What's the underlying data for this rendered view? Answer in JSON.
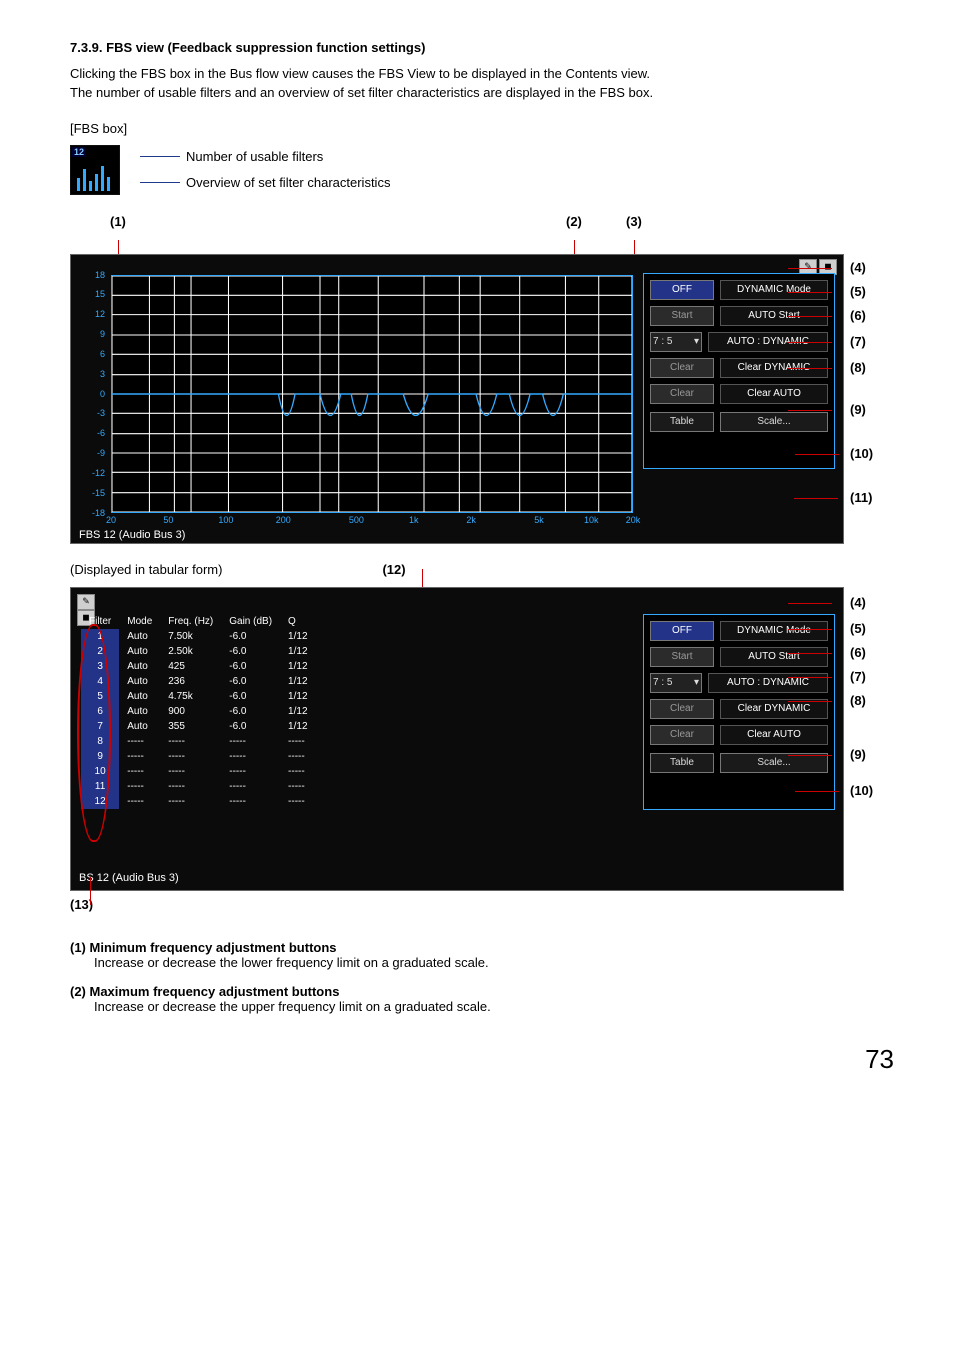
{
  "heading": "7.3.9. FBS view (Feedback suppression function settings)",
  "intro1": "Clicking the FBS box in the Bus flow view causes the FBS View to be displayed in the Contents view.",
  "intro2": "The number of usable filters and an overview of set filter characteristics are displayed in the FBS box.",
  "fbs_box_label": "[FBS box]",
  "fbs_count": "12",
  "annot1": "Number of usable filters",
  "annot2": "Overview of set filter characteristics",
  "callouts_top": {
    "c1": "(1)",
    "c2": "(2)",
    "c3": "(3)"
  },
  "side": {
    "c4": "(4)",
    "c5": "(5)",
    "c6": "(6)",
    "c7": "(7)",
    "c8": "(8)",
    "c9": "(9)",
    "c10": "(10)",
    "c11": "(11)"
  },
  "tab_side": {
    "c4": "(4)",
    "c5": "(5)",
    "c6": "(6)",
    "c7": "(7)",
    "c8": "(8)",
    "c9": "(9)",
    "c10": "(10)"
  },
  "graph": {
    "y_ticks": [
      "18",
      "15",
      "12",
      "9",
      "6",
      "3",
      "0",
      "-3",
      "-6",
      "-9",
      "-12",
      "-15",
      "-18"
    ],
    "x_ticks": [
      {
        "label": "20",
        "pos": 0
      },
      {
        "label": "50",
        "pos": 11
      },
      {
        "label": "100",
        "pos": 22
      },
      {
        "label": "200",
        "pos": 33
      },
      {
        "label": "500",
        "pos": 47
      },
      {
        "label": "1k",
        "pos": 58
      },
      {
        "label": "2k",
        "pos": 69
      },
      {
        "label": "5k",
        "pos": 82
      },
      {
        "label": "10k",
        "pos": 92
      },
      {
        "label": "20k",
        "pos": 100
      }
    ],
    "title": "FBS 12 (Audio Bus 3)"
  },
  "ctrl": {
    "off": "OFF",
    "dyn_mode": "DYNAMIC Mode",
    "start": "Start",
    "auto_start": "AUTO Start",
    "ratio": "7 : 5",
    "auto_dyn": "AUTO : DYNAMIC",
    "clear1": "Clear",
    "clear_dyn": "Clear DYNAMIC",
    "clear2": "Clear",
    "clear_auto": "Clear AUTO",
    "table": "Table",
    "scale": "Scale..."
  },
  "tabular_label": "(Displayed in tabular form)",
  "c12": "(12)",
  "c13": "(13)",
  "table": {
    "headers": [
      "Filter",
      "Mode",
      "Freq. (Hz)",
      "Gain (dB)",
      "Q"
    ],
    "rows": [
      [
        "1",
        "Auto",
        "7.50k",
        "-6.0",
        "1/12"
      ],
      [
        "2",
        "Auto",
        "2.50k",
        "-6.0",
        "1/12"
      ],
      [
        "3",
        "Auto",
        "425",
        "-6.0",
        "1/12"
      ],
      [
        "4",
        "Auto",
        "236",
        "-6.0",
        "1/12"
      ],
      [
        "5",
        "Auto",
        "4.75k",
        "-6.0",
        "1/12"
      ],
      [
        "6",
        "Auto",
        "900",
        "-6.0",
        "1/12"
      ],
      [
        "7",
        "Auto",
        "355",
        "-6.0",
        "1/12"
      ],
      [
        "8",
        "-----",
        "-----",
        "-----",
        "-----"
      ],
      [
        "9",
        "-----",
        "-----",
        "-----",
        "-----"
      ],
      [
        "10",
        "-----",
        "-----",
        "-----",
        "-----"
      ],
      [
        "11",
        "-----",
        "-----",
        "-----",
        "-----"
      ],
      [
        "12",
        "-----",
        "-----",
        "-----",
        "-----"
      ]
    ],
    "title": "BS 12 (Audio Bus 3)"
  },
  "footer": [
    {
      "t": "(1) Minimum frequency adjustment buttons",
      "d": "Increase or decrease the lower frequency limit on a graduated scale."
    },
    {
      "t": "(2) Maximum frequency adjustment buttons",
      "d": "Increase or decrease the upper frequency limit on a graduated scale."
    }
  ],
  "page": "73"
}
